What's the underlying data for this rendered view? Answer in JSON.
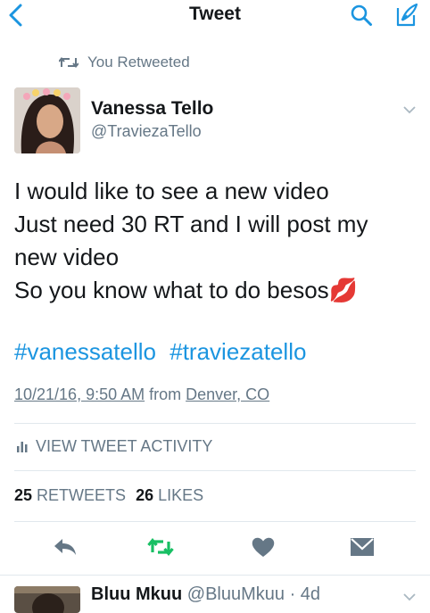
{
  "nav": {
    "title": "Tweet"
  },
  "retweet_context": {
    "label": "You Retweeted"
  },
  "tweet": {
    "author_name": "Vanessa Tello",
    "author_handle": "@TraviezaTello",
    "lines": [
      "I would like to see a new video",
      "Just need 30 RT and I will post my",
      "new video",
      "So you know what to do besos💋"
    ],
    "hashtags": [
      "#vanessatello",
      "#traviezatello"
    ],
    "timestamp": "10/21/16, 9:50 AM",
    "from_label": "from",
    "location": "Denver, CO",
    "activity_label": "VIEW TWEET ACTIVITY",
    "retweets_count": "25",
    "retweets_label": "RETWEETS",
    "likes_count": "26",
    "likes_label": "LIKES"
  },
  "reply": {
    "author_name": "Bluu Mkuu",
    "author_handle": "@BluuMkuu",
    "age": "· 4d"
  },
  "colors": {
    "accent": "#1b95e0",
    "retweet_green": "#17bf63",
    "muted": "#657786"
  }
}
